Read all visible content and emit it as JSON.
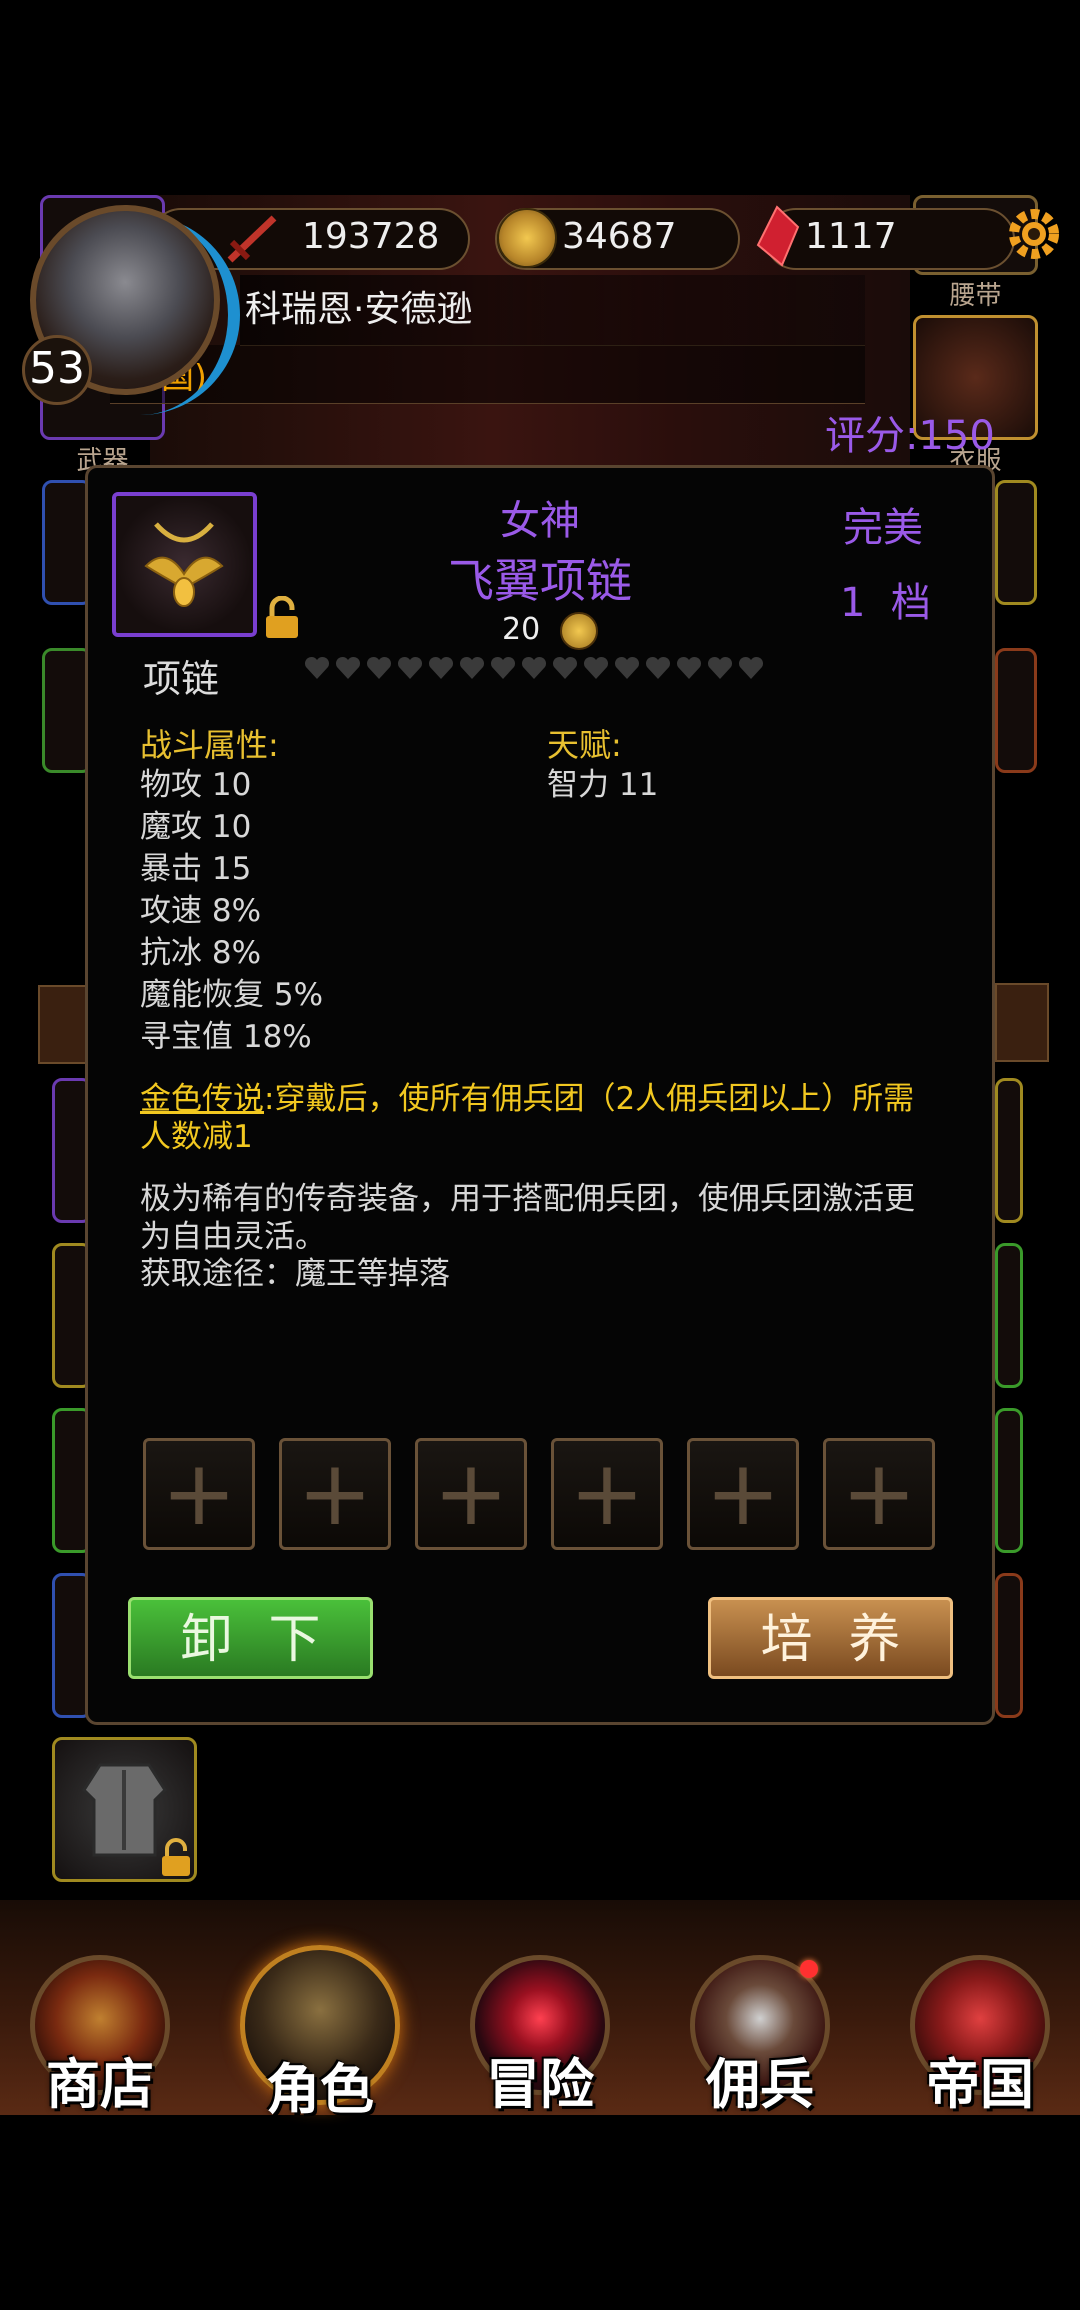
{
  "hud": {
    "combat_power": "193728",
    "gold": "34687",
    "gems": "1117",
    "player_name": "科瑞恩·安德逊",
    "faction": "帝国)",
    "level": "53",
    "score": "评分:150",
    "colors": {
      "score": "#9a5ae8",
      "faction": "#f0a000"
    }
  },
  "equipment_slots": {
    "weapon_label": "武器",
    "belt_label": "腰带",
    "clothes_label": "衣服"
  },
  "item": {
    "title_line1": "女神",
    "title_line2": "飞翼项链",
    "quality": "完美",
    "tier": "1  档",
    "level": "20",
    "type": "项链",
    "hearts": 15,
    "combat_header": "战斗属性:",
    "talent_header": "天赋:",
    "stats": [
      "物攻 10",
      "魔攻 10",
      "暴击 15",
      "攻速 8%",
      "抗冰 8%",
      "魔能恢复 5%",
      "寻宝值 18%"
    ],
    "talents": [
      "智力 11"
    ],
    "legend_name": "金色传说",
    "legend_text": ":穿戴后，使所有佣兵团（2人佣兵团以上）所需人数减1",
    "description": "极为稀有的传奇装备，用于搭配佣兵团，使佣兵团激活更为自由灵活。",
    "source": "获取途径：魔王等掉落",
    "sockets": [
      "+",
      "+",
      "+",
      "+",
      "+",
      "+"
    ],
    "unequip_label": "卸下",
    "train_label": "培养"
  },
  "nav": [
    {
      "label": "商店",
      "icon": "shop-castle-icon"
    },
    {
      "label": "角色",
      "icon": "hooded-character-icon"
    },
    {
      "label": "冒险",
      "icon": "adventure-portal-icon"
    },
    {
      "label": "佣兵",
      "icon": "mercenary-icon"
    },
    {
      "label": "帝国",
      "icon": "empire-banner-icon"
    }
  ]
}
